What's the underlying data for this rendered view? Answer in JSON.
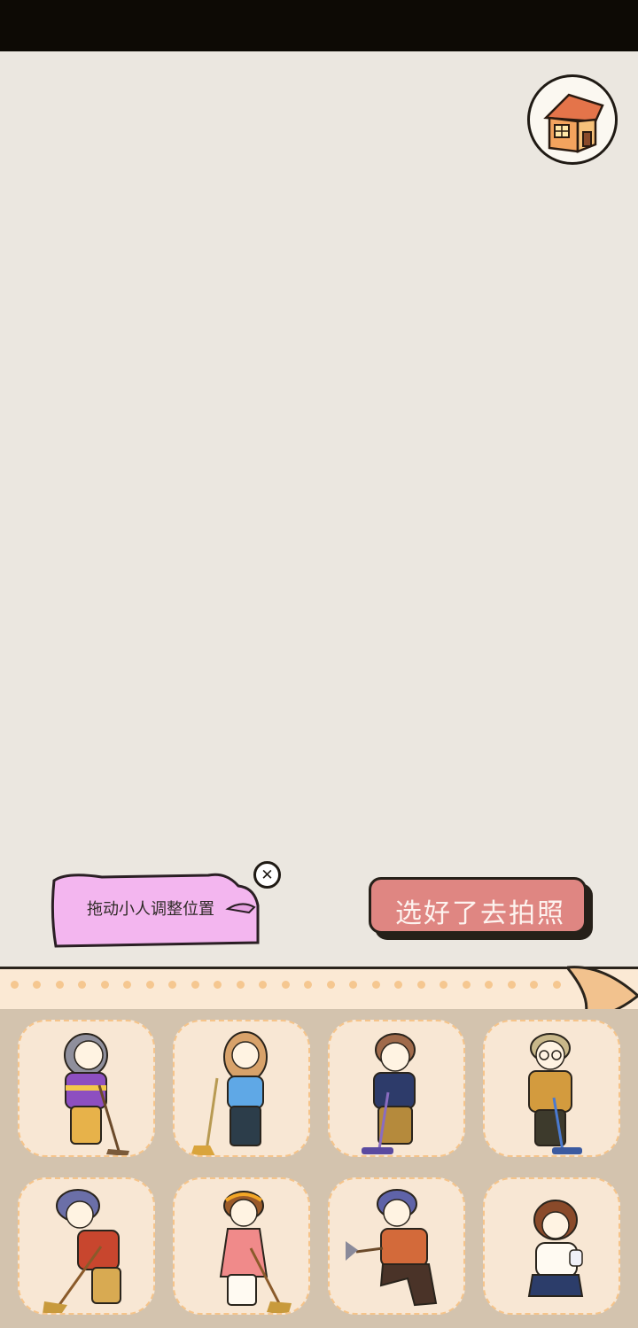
{
  "tip": {
    "text": "拖动小人调整位置"
  },
  "actions": {
    "confirm_label": "选好了去拍照"
  },
  "colors": {
    "stage": "#ebe7e0",
    "tray": "#d3c3ae",
    "button": "#df8682",
    "bubble": "#f3b6ef"
  },
  "icons": {
    "home": "house-icon",
    "close": "close-icon"
  },
  "characters": [
    {
      "name": "character-purple-sweater-sweeping"
    },
    {
      "name": "character-blue-sweater-broom"
    },
    {
      "name": "character-jacket-vacuum"
    },
    {
      "name": "character-glasses-vacuum"
    },
    {
      "name": "character-red-jacket-broom"
    },
    {
      "name": "character-pink-dress-broom"
    },
    {
      "name": "character-kneeling-duster"
    },
    {
      "name": "character-girl-spray-bottle"
    }
  ]
}
